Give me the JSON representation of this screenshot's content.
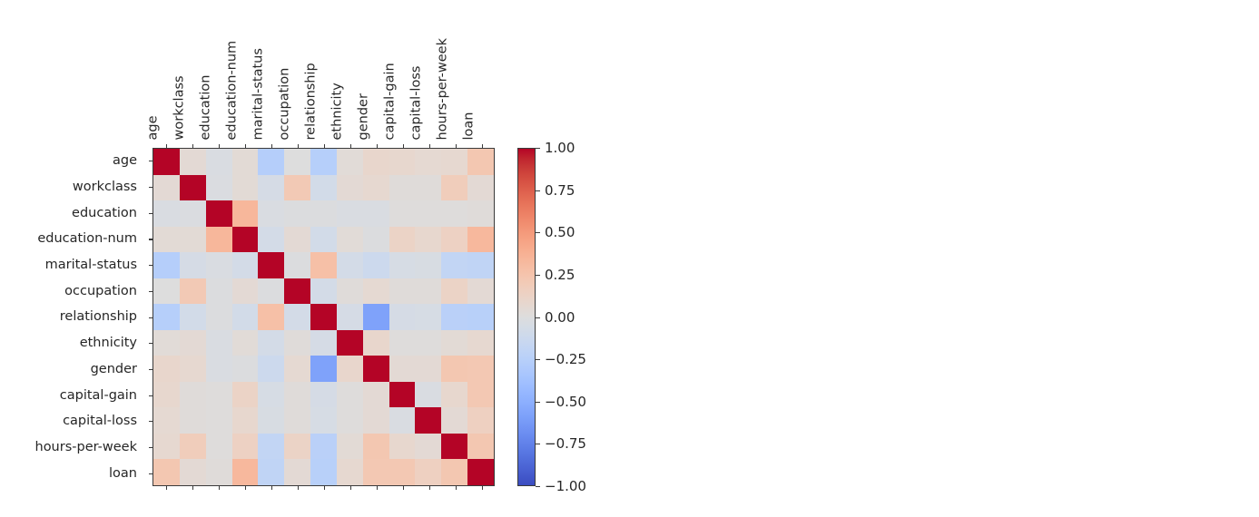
{
  "chart_data": {
    "type": "heatmap",
    "title": "",
    "xlabel": "",
    "ylabel": "",
    "colormap": "coolwarm",
    "vmin": -1.0,
    "vmax": 1.0,
    "grid": false,
    "legend_position": "right",
    "colorbar": {
      "label": "",
      "ticks": [
        1.0,
        0.75,
        0.5,
        0.25,
        0.0,
        -0.25,
        -0.5,
        -0.75,
        -1.0
      ],
      "tick_labels": [
        "1.00",
        "0.75",
        "0.50",
        "0.25",
        "0.00",
        "−0.25",
        "−0.50",
        "−0.75",
        "−1.00"
      ],
      "range": [
        -1.0,
        1.0
      ],
      "orientation": "vertical"
    },
    "categories": [
      "age",
      "workclass",
      "education",
      "education-num",
      "marital-status",
      "occupation",
      "relationship",
      "ethnicity",
      "gender",
      "capital-gain",
      "capital-loss",
      "hours-per-week",
      "loan"
    ],
    "x_tick_labels": [
      "age",
      "workclass",
      "education",
      "education-num",
      "marital-status",
      "occupation",
      "relationship",
      "ethnicity",
      "gender",
      "capital-gain",
      "capital-loss",
      "hours-per-week",
      "loan"
    ],
    "y_tick_labels": [
      "age",
      "workclass",
      "education",
      "education-num",
      "marital-status",
      "occupation",
      "relationship",
      "ethnicity",
      "gender",
      "capital-gain",
      "capital-loss",
      "hours-per-week",
      "loan"
    ],
    "values": [
      [
        1.0,
        0.05,
        -0.03,
        0.04,
        -0.27,
        0.0,
        -0.26,
        0.03,
        0.09,
        0.08,
        0.06,
        0.07,
        0.23
      ],
      [
        0.05,
        1.0,
        -0.02,
        0.04,
        -0.06,
        0.21,
        -0.08,
        0.05,
        0.07,
        0.02,
        0.02,
        0.18,
        0.05
      ],
      [
        -0.03,
        -0.02,
        1.0,
        0.34,
        -0.03,
        -0.01,
        -0.01,
        -0.03,
        -0.03,
        0.01,
        0.01,
        0.01,
        0.02
      ],
      [
        0.04,
        0.04,
        0.34,
        1.0,
        -0.07,
        0.05,
        -0.08,
        0.03,
        -0.01,
        0.12,
        0.08,
        0.14,
        0.33
      ],
      [
        -0.27,
        -0.06,
        -0.03,
        -0.07,
        1.0,
        -0.01,
        0.28,
        -0.07,
        -0.12,
        -0.05,
        -0.04,
        -0.19,
        -0.2
      ],
      [
        0.0,
        0.21,
        -0.01,
        0.05,
        -0.01,
        1.0,
        -0.07,
        0.02,
        0.06,
        0.02,
        0.02,
        0.12,
        0.05
      ],
      [
        -0.26,
        -0.08,
        -0.01,
        -0.08,
        0.28,
        -0.07,
        1.0,
        -0.06,
        -0.58,
        -0.06,
        -0.05,
        -0.24,
        -0.25
      ],
      [
        0.03,
        0.05,
        -0.03,
        0.03,
        -0.07,
        0.02,
        -0.06,
        1.0,
        0.09,
        0.01,
        0.01,
        0.04,
        0.07
      ],
      [
        0.09,
        0.07,
        -0.03,
        -0.01,
        -0.12,
        0.06,
        -0.58,
        0.09,
        1.0,
        0.05,
        0.05,
        0.23,
        0.22
      ],
      [
        0.08,
        0.02,
        0.01,
        0.12,
        -0.05,
        0.02,
        -0.06,
        0.01,
        0.05,
        1.0,
        -0.03,
        0.08,
        0.22
      ],
      [
        0.06,
        0.02,
        0.01,
        0.08,
        -0.04,
        0.02,
        -0.05,
        0.01,
        0.05,
        -0.03,
        1.0,
        0.05,
        0.15
      ],
      [
        0.07,
        0.18,
        0.01,
        0.14,
        -0.19,
        0.12,
        -0.24,
        0.04,
        0.23,
        0.08,
        0.05,
        1.0,
        0.23
      ],
      [
        0.23,
        0.05,
        0.02,
        0.33,
        -0.2,
        0.05,
        -0.25,
        0.07,
        0.22,
        0.22,
        0.15,
        0.23,
        1.0
      ]
    ]
  }
}
